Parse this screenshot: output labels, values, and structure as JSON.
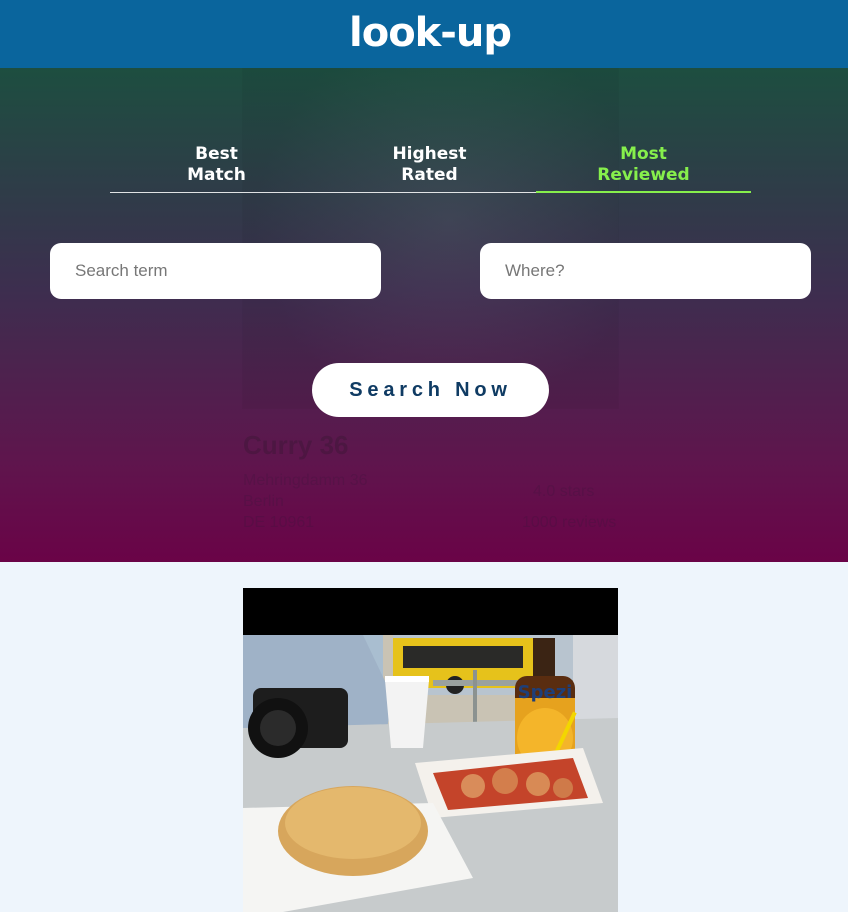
{
  "header": {
    "logo": "look-up"
  },
  "tabs": [
    {
      "label": "Best\nMatch",
      "active": false
    },
    {
      "label": "Highest\nRated",
      "active": false
    },
    {
      "label": "Most\nReviewed",
      "active": true
    }
  ],
  "search": {
    "term_placeholder": "Search term",
    "location_placeholder": "Where?",
    "button_label": "Search Now"
  },
  "background_result": {
    "name": "Curry 36",
    "address_1": "Mehringdamm 36",
    "address_2": "Berlin",
    "address_3": "DE 10961",
    "rating": "4.0 stars",
    "reviews": "1000 reviews"
  },
  "colors": {
    "header_bg": "#0a659d",
    "active_tab": "#86ef4c",
    "button_text": "#0f3b63",
    "page_bg": "#eef5fc"
  },
  "result_image": {
    "bottle_text": "Spezi",
    "alt": "currywurst-photo"
  }
}
